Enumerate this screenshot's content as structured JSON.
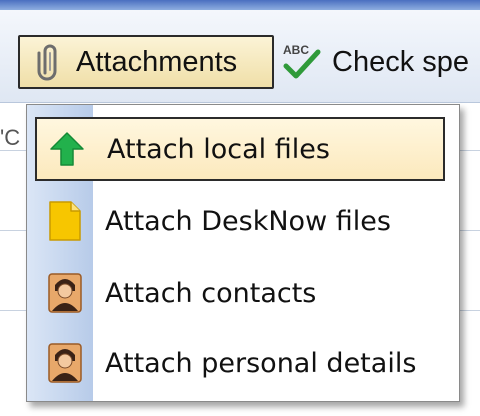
{
  "toolbar": {
    "attachments": {
      "label": "Attachments",
      "icon": "paperclip-icon"
    },
    "spell_check": {
      "label": "Check spe",
      "icon": "spell-check-icon",
      "icon_text": "ABC"
    }
  },
  "background": {
    "fragment_text": "'C"
  },
  "menu": {
    "items": [
      {
        "label": "Attach local files",
        "icon": "upload-arrow-icon",
        "selected": true
      },
      {
        "label": "Attach DeskNow files",
        "icon": "document-icon",
        "selected": false
      },
      {
        "label": "Attach contacts",
        "icon": "contact-person-icon",
        "selected": false
      },
      {
        "label": "Attach personal details",
        "icon": "person-details-icon",
        "selected": false
      }
    ]
  },
  "colors": {
    "selected_bg": "#fce9bd",
    "gutter": "#b7cbe9",
    "toolbar_bg": "#dfe7f3",
    "arrow_green": "#22b14c",
    "document_yellow": "#f7c600"
  }
}
